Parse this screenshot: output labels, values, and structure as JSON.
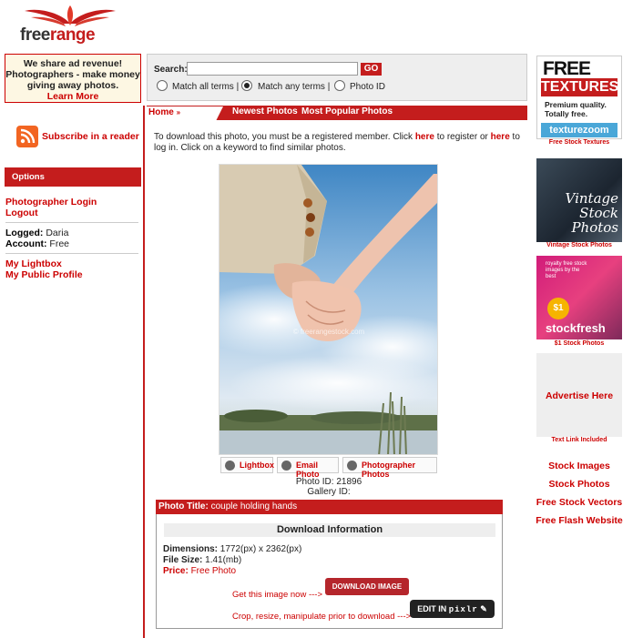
{
  "logo": {
    "text_free": "free",
    "text_range": "range"
  },
  "adbox": {
    "line1": "We share ad revenue!",
    "line2": "Photographers - make money",
    "line3": "giving away photos.",
    "link": "Learn More"
  },
  "subscribe": {
    "label": "Subscribe in a reader",
    "icon": "rss-icon"
  },
  "options": {
    "title": "Options"
  },
  "account": {
    "login": "Photographer Login",
    "logout": "Logout",
    "logged_label": "Logged:",
    "logged_value": "Daria",
    "account_label": "Account:",
    "account_value": "Free",
    "lightbox": "My Lightbox",
    "profile": "My Public Profile"
  },
  "search": {
    "label": "Search:",
    "value": "",
    "go": "GO",
    "options": [
      {
        "label": "Match all terms |",
        "selected": false
      },
      {
        "label": "Match any terms |",
        "selected": true
      },
      {
        "label": "Photo ID",
        "selected": false
      }
    ]
  },
  "nav": {
    "home": "Home",
    "sep": "»",
    "newest": "Newest Photos",
    "popular": "Most Popular Photos"
  },
  "intro": {
    "part1": "To download this photo, you must be a registered member. Click ",
    "here1": "here",
    "part2": " to register or ",
    "here2": "here",
    "part3": " to log in. Click on a keyword to find similar photos."
  },
  "photo": {
    "watermark": "© freerangestock.com"
  },
  "actions": {
    "lightbox": "Lightbox",
    "email": "Email Photo",
    "photographer": "Photographer Photos"
  },
  "meta": {
    "photo_id": "Photo ID: 21896",
    "gallery_id": "Gallery ID:"
  },
  "details": {
    "title_label": "Photo Title:",
    "title_value": "couple holding hands",
    "download_header": "Download Information",
    "dimensions_label": "Dimensions:",
    "dimensions_value": "1772(px) x 2362(px)",
    "filesize_label": "File Size:",
    "filesize_value": "1.41(mb)",
    "price_label": "Price:",
    "price_value": "Free Photo",
    "get_image": "Get this image now --->",
    "download_button": "DOWNLOAD IMAGE",
    "crop_text": "Crop, resize, manipulate prior to download --->",
    "pixlr_prefix": "EDIT IN",
    "pixlr_name": "pixlr"
  },
  "right": {
    "tex": {
      "l1": "FREE",
      "l2": "TEXTURES",
      "l3a": "Premium quality.",
      "l3b": "Totally free.",
      "l4": "texturezoom",
      "caption": "Free Stock Textures"
    },
    "vint": {
      "text": "Vintage Stock Photos",
      "caption": "Vintage Stock Photos"
    },
    "stockf": {
      "small": "royalty free stock images by the best",
      "price": "$1",
      "brand": "stockfresh",
      "caption": "$1 Stock Photos"
    },
    "advert": {
      "text": "Advertise Here",
      "caption": "Text Link Included"
    },
    "links": [
      "Stock Images",
      "Stock Photos",
      "Free Stock Vectors",
      "Free Flash Website"
    ]
  }
}
